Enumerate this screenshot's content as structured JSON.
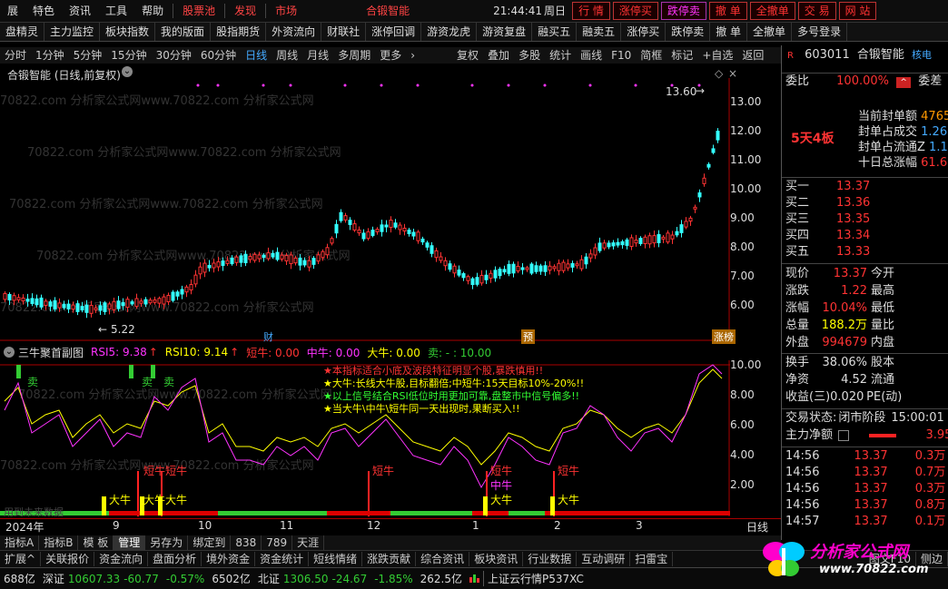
{
  "menu": {
    "items": [
      "展",
      "特色",
      "资讯",
      "工具",
      "帮助"
    ],
    "highlight": [
      "股票池",
      "发现",
      "市场"
    ],
    "center_title": "合锻智能",
    "time": "21:44:41",
    "weekday": "周日",
    "trade_buttons": [
      "行 情",
      "涨停买",
      "跌停卖",
      "撤 单",
      "全撤单",
      "交 易",
      "网 站"
    ]
  },
  "func_buttons": [
    "盘精灵",
    "主力监控",
    "板块指数",
    "我的版面",
    "股指期货",
    "外资流向",
    "财联社",
    "涨停回调",
    "游资龙虎",
    "游资复盘",
    "融买五",
    "融卖五",
    "涨停买",
    "跌停卖",
    "撤 单",
    "全撤单",
    "多号登录"
  ],
  "period": {
    "items": [
      "分时",
      "1分钟",
      "5分钟",
      "15分钟",
      "30分钟",
      "60分钟",
      "日线",
      "周线",
      "月线",
      "多周期",
      "更多"
    ],
    "selected": "日线",
    "tools": [
      "复权",
      "叠加",
      "多股",
      "统计",
      "画线",
      "F10",
      "简框",
      "标记",
      "+自选",
      "返回"
    ]
  },
  "main_chart": {
    "title": "合锻智能 (日线,前复权)",
    "yticks": [
      "13.00",
      "12.00",
      "11.00",
      "10.00",
      "9.00",
      "8.00",
      "7.00",
      "6.00"
    ],
    "high_label": "13.60",
    "low_label": "5.22",
    "markers": [
      "财",
      "预",
      "涨榜"
    ],
    "watermark": "70822.com 分析家公式网www.70822.com 分析家公式网"
  },
  "sub_chart": {
    "title": "三牛聚首副图",
    "rsi5_label": "RSI5: 9.38",
    "rsi10_label": "RSI10: 9.14",
    "short_label": "短牛: 0.00",
    "mid_label": "中牛: 0.00",
    "big_label": "大牛: 0.00",
    "sell_label": "卖: - : 10.00",
    "yticks": [
      "10.00",
      "8.00",
      "6.00",
      "4.00",
      "2.00"
    ],
    "notes": [
      "★本指标适合小底及波段特征明显个股,暴跌慎用!!",
      "★大牛:长线大牛股,目标翻倍;中短牛:15天目标10%-20%!!",
      "★以上信号结合RSI低位时用更加可靠,盘整市中信号偏多!!",
      "★当大牛\\中牛\\短牛同一天出现时,果断买入!!"
    ],
    "sell_marks": [
      "卖",
      "卖",
      "卖"
    ],
    "short_marks": [
      "短牛",
      "短牛",
      "短牛",
      "短牛",
      "短牛"
    ],
    "mid_marks": [
      "中牛"
    ],
    "big_marks": [
      "大牛",
      "大牛",
      "大牛",
      "大牛",
      "大牛"
    ],
    "future_label": "用到未来数据"
  },
  "xaxis": {
    "labels": [
      "2024年",
      "9",
      "10",
      "11",
      "12",
      "1",
      "2",
      "3"
    ],
    "right": "日线"
  },
  "right_panel": {
    "code": "603011",
    "name": "合锻智能",
    "badge_r": "R",
    "nuclear": "核电",
    "weibi_label": "委比",
    "weibi_value": "100.00%",
    "weicha_label": "委差",
    "streak": "5天4板",
    "seal_rows": [
      {
        "label": "当前封单额",
        "value": "4765"
      },
      {
        "label": "封单占成交",
        "value": "1.26"
      },
      {
        "label": "封单占流通Z",
        "value": "1.11"
      },
      {
        "label": "十日总涨幅",
        "value": "61.67"
      }
    ],
    "buys": [
      {
        "label": "买一",
        "price": "13.37"
      },
      {
        "label": "买二",
        "price": "13.36"
      },
      {
        "label": "买三",
        "price": "13.35"
      },
      {
        "label": "买四",
        "price": "13.34"
      },
      {
        "label": "买五",
        "price": "13.33"
      }
    ],
    "quote": [
      {
        "l1": "现价",
        "v1": "13.37",
        "l2": "今开",
        "v2": ""
      },
      {
        "l1": "涨跌",
        "v1": "1.22",
        "l2": "最高",
        "v2": ""
      },
      {
        "l1": "涨幅",
        "v1": "10.04%",
        "l2": "最低",
        "v2": ""
      },
      {
        "l1": "总量",
        "v1": "188.2万",
        "l2": "量比",
        "v2": ""
      },
      {
        "l1": "外盘",
        "v1": "994679",
        "l2": "内盘",
        "v2": ""
      }
    ],
    "turnover": [
      {
        "l1": "换手",
        "v1": "38.06%",
        "l2": "股本"
      },
      {
        "l1": "净资",
        "v1": "4.52",
        "l2": "流通"
      },
      {
        "l1": "收益(三)",
        "v1": "0.020",
        "l2": "PE(动)"
      }
    ],
    "trade_state_label": "交易状态:",
    "trade_state_value": "闭市阶段",
    "trade_state_time": "15:00:01",
    "main_net_label": "主力净额",
    "main_net_value": "3.95",
    "ticks": [
      {
        "t": "14:56",
        "p": "13.37",
        "v": "0.3万"
      },
      {
        "t": "14:56",
        "p": "13.37",
        "v": "0.7万"
      },
      {
        "t": "14:56",
        "p": "13.37",
        "v": "0.3万"
      },
      {
        "t": "14:56",
        "p": "13.37",
        "v": "0.8万"
      },
      {
        "t": "14:57",
        "p": "13.37",
        "v": "0.1万"
      },
      {
        "t": "15:00",
        "p": "13.37",
        "v": "0.9万"
      }
    ]
  },
  "tabs1": [
    "指标A",
    "指标B",
    "模 板",
    "管理",
    "另存为",
    "绑定到",
    "838",
    "789",
    "天涯"
  ],
  "tabs1_selected": "管理",
  "tabs2": [
    "扩展^",
    "关联报价",
    "资金流向",
    "盘面分析",
    "境外资金",
    "资金统计",
    "短线情绪",
    "涨跌贡献",
    "综合资讯",
    "板块资讯",
    "行业数据",
    "互动调研",
    "扫雷宝"
  ],
  "tabs2_right": [
    "图文F10",
    "侧边"
  ],
  "status": {
    "sh_amt": "688亿",
    "sz_label": "深证",
    "sz_val": "10607.33",
    "sz_chg": "-60.77",
    "sz_pct": "-0.57%",
    "sz_amt": "6502亿",
    "bz_label": "北证",
    "bz_val": "1306.50",
    "bz_chg": "-24.67",
    "bz_pct": "-1.85%",
    "bz_amt": "262.5亿",
    "ticker": "上证云行情P537XC"
  },
  "logo": {
    "title": "分析家公式网",
    "url": "www.70822.com"
  }
}
